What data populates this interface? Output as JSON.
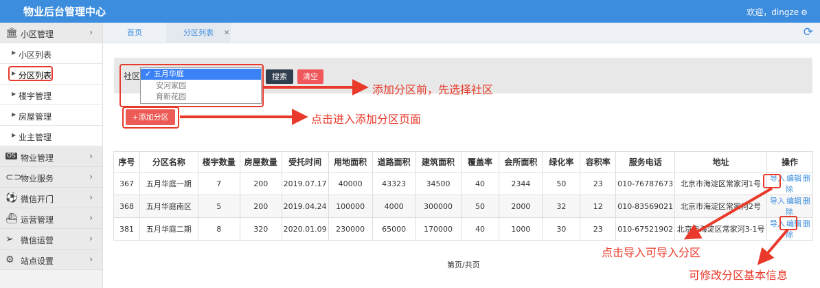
{
  "header": {
    "title": "物业后台管理中心",
    "welcome": "欢迎，dingze",
    "settings_icon": "gear-icon"
  },
  "sidebar": {
    "sections": [
      {
        "icon": "bank-icon",
        "label": "小区管理",
        "expanded": true,
        "items": [
          "小区列表",
          "分区列表",
          "楼宇管理",
          "房屋管理",
          "业主管理"
        ],
        "active_item": "分区列表"
      },
      {
        "icon": "os-icon",
        "label": "物业管理"
      },
      {
        "icon": "toggle-icon",
        "label": "物业服务"
      },
      {
        "icon": "soccer-icon",
        "label": "微信开门"
      },
      {
        "icon": "ship-icon",
        "label": "运营管理"
      },
      {
        "icon": "send-icon",
        "label": "微信运营"
      },
      {
        "icon": "gears-icon",
        "label": "站点设置"
      }
    ]
  },
  "tabs": [
    {
      "label": "首页",
      "active": false
    },
    {
      "label": "分区列表",
      "active": true,
      "close": "×"
    }
  ],
  "filter": {
    "label": "社区",
    "options": [
      "五月华庭",
      "安河家园",
      "育新花园"
    ],
    "selected": "✓ 五月华庭",
    "search_label": "搜索",
    "clear_label": "清空"
  },
  "add_button_label": "+添加分区",
  "annotations": {
    "select_first": "添加分区前，先选择社区",
    "click_add": "点击进入添加分区页面",
    "click_import": "点击导入可导入分区",
    "edit_info": "可修改分区基本信息"
  },
  "table": {
    "columns": [
      "序号",
      "分区名称",
      "楼宇数量",
      "房屋数量",
      "受托时间",
      "用地面积",
      "道路面积",
      "建筑面积",
      "覆盖率",
      "会所面积",
      "绿化率",
      "容积率",
      "服务电话",
      "地址",
      "操作"
    ],
    "rows": [
      [
        "367",
        "五月华庭一期",
        "7",
        "200",
        "2019.07.17",
        "40000",
        "43323",
        "34500",
        "40",
        "2344",
        "50",
        "23",
        "010-76787673",
        "北京市海淀区常家河1号"
      ],
      [
        "368",
        "五月华庭南区",
        "5",
        "200",
        "2019.04.24",
        "100000",
        "4000",
        "300000",
        "50",
        "2000",
        "32",
        "12",
        "010-83569021",
        "北京市海淀区常家河2号"
      ],
      [
        "381",
        "五月华庭二期",
        "8",
        "320",
        "2020.01.09",
        "230000",
        "65000",
        "170000",
        "40",
        "1000",
        "30",
        "23",
        "010-67521902",
        "北京市海淀区常家河3-1号"
      ]
    ],
    "actions": [
      "导入",
      "编辑",
      "删除"
    ]
  },
  "pager": {
    "text": "第页/共页"
  },
  "colors": {
    "brand": "#3c8dde",
    "annotation": "#e8392a",
    "danger": "#f0575a",
    "dark": "#2f3e4d"
  }
}
